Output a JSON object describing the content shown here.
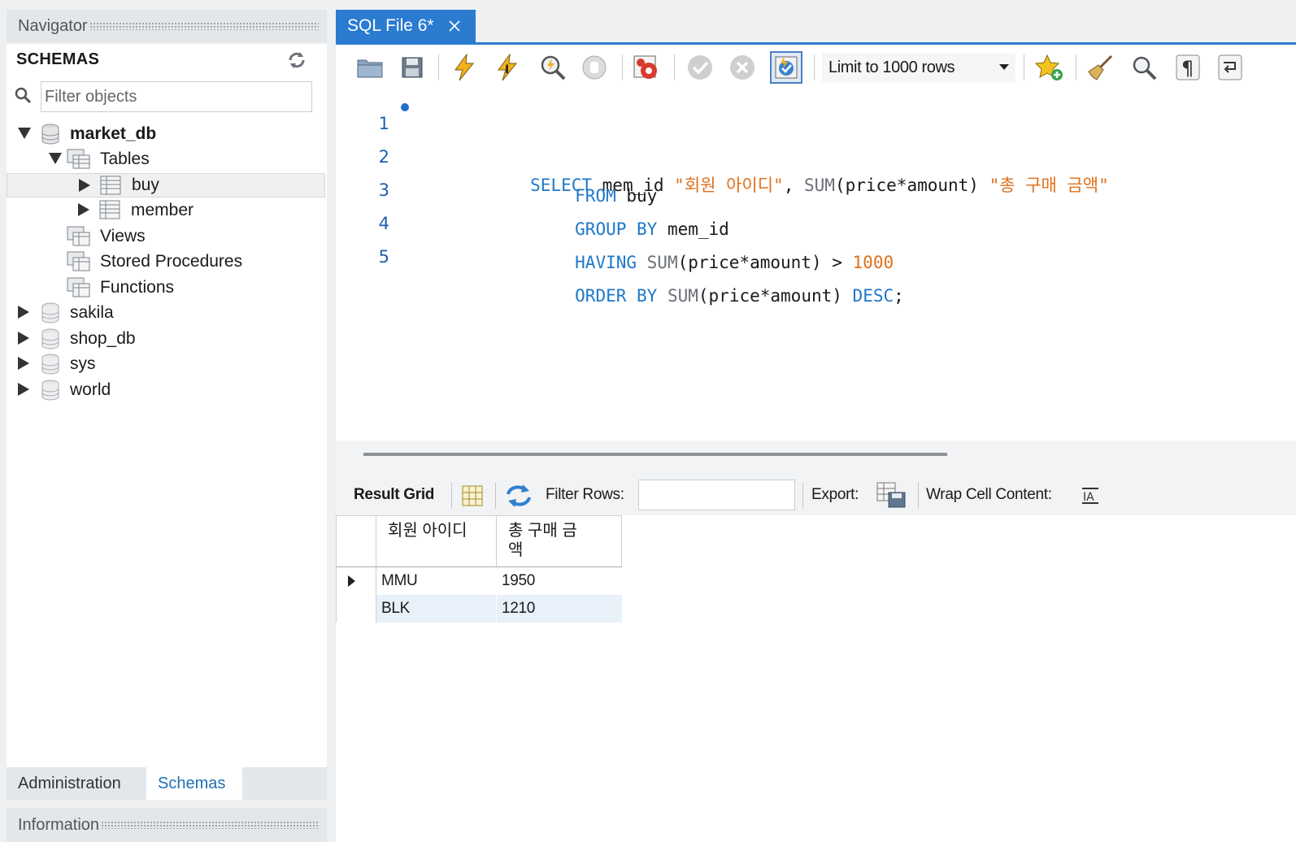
{
  "navigator": {
    "title": "Navigator",
    "schemas_title": "SCHEMAS",
    "filter_placeholder": "Filter objects",
    "tree": {
      "market_db": "market_db",
      "tables": "Tables",
      "buy": "buy",
      "member": "member",
      "views": "Views",
      "stored_procedures": "Stored Procedures",
      "functions": "Functions",
      "sakila": "sakila",
      "shop_db": "shop_db",
      "sys": "sys",
      "world": "world"
    },
    "tabs": {
      "administration": "Administration",
      "schemas": "Schemas"
    },
    "information": "Information"
  },
  "editor": {
    "tab_label": "SQL File 6*",
    "limit_label": "Limit to 1000 rows",
    "lines": [
      {
        "num": "1"
      },
      {
        "num": "2"
      },
      {
        "num": "3"
      },
      {
        "num": "4"
      },
      {
        "num": "5"
      }
    ],
    "code": {
      "l1_select": "SELECT",
      "l1_col": " mem_id ",
      "l1_alias1": "\"회원 아이디\"",
      "l1_comma": ", ",
      "l1_sum": "SUM",
      "l1_expr": "(price*amount) ",
      "l1_alias2": "\"총 구매 금액\"",
      "l2_from": "FROM",
      "l2_table": " buy",
      "l3_group": "GROUP BY",
      "l3_col": " mem_id",
      "l4_having": "HAVING",
      "l4_sum": " SUM",
      "l4_expr": "(price*amount) > ",
      "l4_num": "1000",
      "l5_order": "ORDER BY",
      "l5_sum": " SUM",
      "l5_expr": "(price*amount) ",
      "l5_desc": "DESC",
      "l5_semi": ";"
    }
  },
  "result": {
    "result_grid_label": "Result Grid",
    "filter_rows_label": "Filter Rows:",
    "export_label": "Export:",
    "wrap_label": "Wrap Cell Content:",
    "columns": [
      "회원 아이디",
      "총 구매 금액"
    ],
    "rows": [
      [
        "MMU",
        "1950"
      ],
      [
        "BLK",
        "1210"
      ]
    ]
  }
}
